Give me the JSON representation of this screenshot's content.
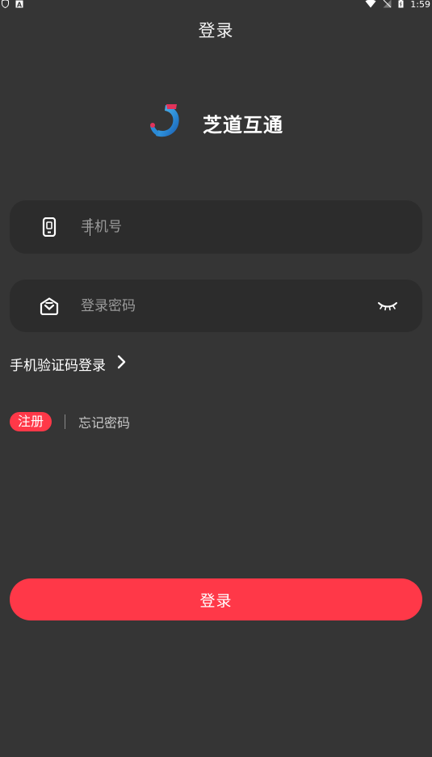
{
  "status_bar": {
    "time": "1:59",
    "left_icons": [
      "shield-icon",
      "a-icon"
    ],
    "right_icons": [
      "wifi-icon",
      "no-signal-icon",
      "battery-icon"
    ]
  },
  "header": {
    "title": "登录"
  },
  "brand": {
    "name": "芝道互通",
    "logo_colors": {
      "primary": "#2a8ad6",
      "accent": "#e2335a"
    }
  },
  "phone_field": {
    "placeholder": "手机号",
    "value": "",
    "icon": "phone-icon"
  },
  "password_field": {
    "placeholder": "登录密码",
    "value": "",
    "icon": "lock-mail-icon",
    "toggle_icon": "eye-closed-icon"
  },
  "sms_login": {
    "label": "手机验证码登录",
    "icon": "chevron-right-icon"
  },
  "links": {
    "register": "注册",
    "forgot_password": "忘记密码"
  },
  "login_button": {
    "label": "登录"
  },
  "colors": {
    "background": "#353535",
    "field_background": "#2c2c2c",
    "accent": "#ff3848"
  }
}
